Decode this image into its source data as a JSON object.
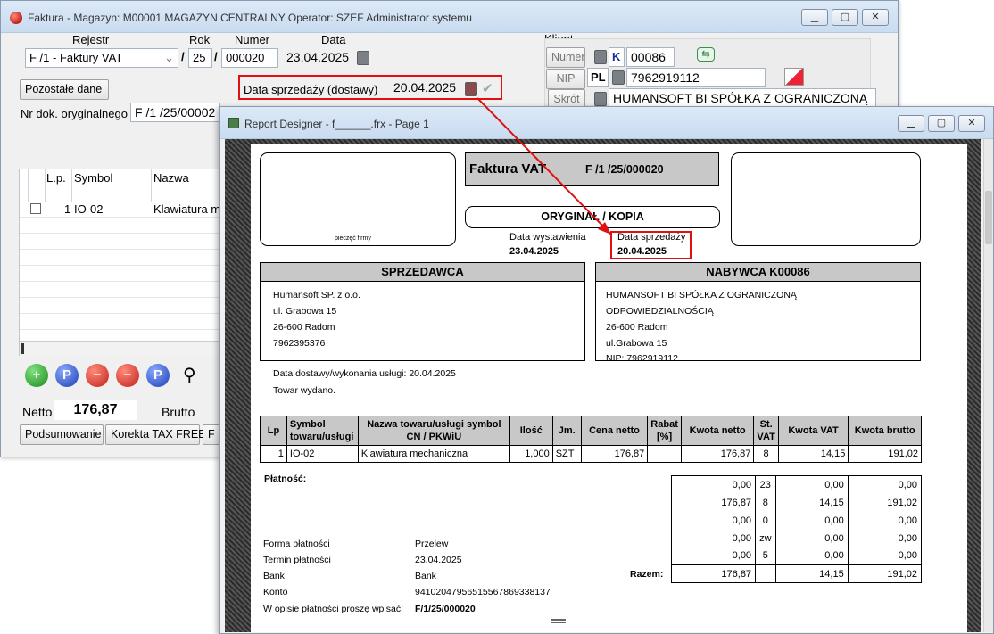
{
  "faktura_window": {
    "title": "Faktura - Magazyn: M00001 MAGAZYN CENTRALNY  Operator: SZEF Administrator systemu",
    "labels": {
      "rejestr": "Rejestr",
      "rok": "Rok",
      "numer": "Numer",
      "data": "Data",
      "klient": "Klient",
      "nr_dok": "Nr dok. oryginalnego",
      "data_sprzedazy": "Data sprzedaży (dostawy)",
      "netto": "Netto",
      "brutto": "Brutto"
    },
    "rejestr_value": "F /1   - Faktury VAT",
    "slash": "/",
    "rok_value": "25",
    "numer_value": "000020",
    "data_value": "23.04.2025",
    "data_sprzedazy_value": "20.04.2025",
    "nr_dok_value": "F /1  /25/00002",
    "klient": {
      "numer_btn": "Numer",
      "nip_btn": "NIP",
      "skrot_btn": "Skrót",
      "k_flag": "K",
      "numer_value": "00086",
      "pl_flag": "PL",
      "nip_value": "7962919112",
      "skrot_value": "HUMANSOFT BI SPÓŁKA Z OGRANICZONĄ"
    },
    "pozostale_btn": "Pozostałe dane",
    "grid": {
      "col_lp": "L.p.",
      "col_symbol": "Symbol",
      "col_nazwa": "Nazwa",
      "row1_lp": "1",
      "row1_symbol": "IO-02",
      "row1_nazwa": "Klawiatura m"
    },
    "toolbar": {
      "add": "+",
      "p1": "P",
      "minus": "−",
      "minus2": "−",
      "p2": "P"
    },
    "netto_value": "176,87",
    "bottom_buttons": {
      "podsumowanie": "Podsumowanie",
      "korekta": "Korekta TAX FREE",
      "extra": "F"
    }
  },
  "report_window": {
    "title": "Report Designer - f______.frx - Page 1",
    "header": {
      "doc_title": "Faktura VAT",
      "doc_number": "F /1  /25/000020",
      "oryginal": "ORYGINAŁ / KOPIA",
      "pieczec": "pieczęć firmy"
    },
    "dates": {
      "wystawienia_label": "Data wystawienia",
      "wystawienia_value": "23.04.2025",
      "sprzedazy_label": "Data sprzedaży",
      "sprzedazy_value": "20.04.2025"
    },
    "seller": {
      "header": "SPRZEDAWCA",
      "lines": [
        "Humansoft SP. z o.o.",
        "ul. Grabowa 15",
        "26-600 Radom",
        "7962395376"
      ]
    },
    "buyer": {
      "header": "NABYWCA  K00086",
      "lines": [
        "HUMANSOFT BI SPÓŁKA Z OGRANICZONĄ",
        "ODPOWIEDZIALNOŚCIĄ",
        "26-600  Radom",
        "ul.Grabowa 15",
        "NIP: 7962919112"
      ]
    },
    "delivery": {
      "data_dostawy": "Data dostawy/wykonania usługi: 20.04.2025",
      "towar": "Towar wydano."
    },
    "items_table": {
      "headers": [
        "Lp",
        "Symbol towaru/usługi",
        "Nazwa towaru/usługi symbol CN / PKWiU",
        "Ilość",
        "Jm.",
        "Cena netto",
        "Rabat [%]",
        "Kwota netto",
        "St. VAT",
        "Kwota VAT",
        "Kwota brutto"
      ],
      "rows": [
        [
          "1",
          "IO-02",
          "Klawiatura mechaniczna",
          "1,000",
          "SZT",
          "176,87",
          "",
          "176,87",
          "8",
          "14,15",
          "191,02"
        ]
      ]
    },
    "vat_summary": {
      "rows": [
        [
          "0,00",
          "23",
          "0,00",
          "0,00"
        ],
        [
          "176,87",
          "8",
          "14,15",
          "191,02"
        ],
        [
          "0,00",
          "0",
          "0,00",
          "0,00"
        ],
        [
          "0,00",
          "zw",
          "0,00",
          "0,00"
        ],
        [
          "0,00",
          "5",
          "0,00",
          "0,00"
        ]
      ],
      "razem_label": "Razem:",
      "razem": [
        "176,87",
        "",
        "14,15",
        "191,02"
      ]
    },
    "payment": {
      "header": "Płatność:",
      "forma_label": "Forma płatności",
      "forma_value": "Przelew",
      "termin_label": "Termin płatności",
      "termin_value": "23.04.2025",
      "bank_label": "Bank",
      "bank_value": "Bank",
      "konto_label": "Konto",
      "konto_value": "94102047956515567869338137",
      "opis_label": "W opisie płatności proszę wpisać:",
      "opis_value": "F/1/25/000020"
    }
  },
  "colors": {
    "highlight": "#e01010",
    "title_gradient": "#dce9f7",
    "header_gray": "#c8c8c8"
  }
}
